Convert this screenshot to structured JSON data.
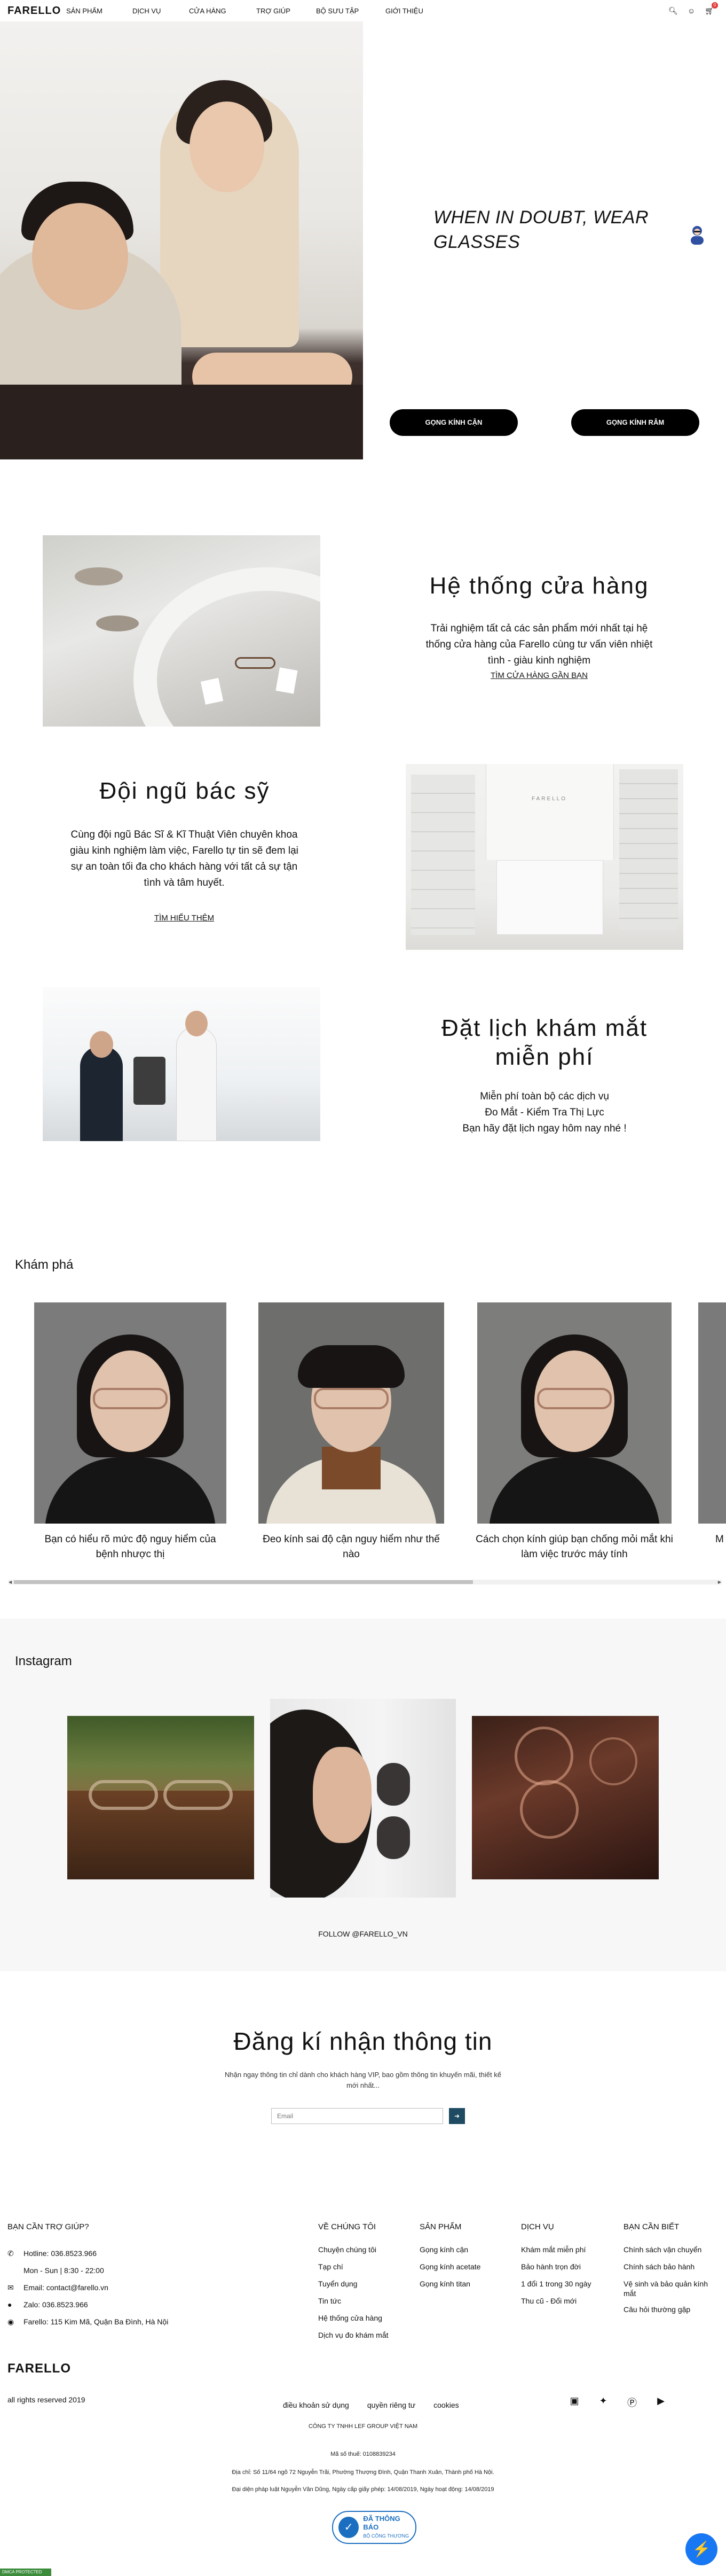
{
  "header": {
    "logo": "FARELLO",
    "nav": [
      "SẢN PHẨM",
      "DỊCH VỤ",
      "CỬA HÀNG",
      "TRỢ GIÚP",
      "BỘ SƯU TẬP",
      "GIỚI THIỆU"
    ],
    "icons": [
      "search-icon",
      "user-icon",
      "cart-icon"
    ],
    "cart_count": "0"
  },
  "hero": {
    "tagline_line1": "WHEN IN DOUBT, WEAR",
    "tagline_line2": "GLASSES",
    "btn_can": "GỌNG KÍNH CẬN",
    "btn_ram": "GỌNG KÍNH RÂM"
  },
  "store": {
    "title": "Hệ thống cửa hàng",
    "text": "Trải nghiệm tất cả các sản phẩm mới nhất tại hệ thống cửa hàng của Farello cùng tư vấn viên nhiệt tình - giàu kinh nghiệm",
    "link": "TÌM CỬA HÀNG GẦN BẠN"
  },
  "doctor": {
    "title": "Đội ngũ bác sỹ",
    "text": "Cùng đội ngũ Bác Sĩ & Kĩ Thuật Viên chuyên khoa giàu kinh nghiệm làm việc, Farello tự tin sẽ đem lại sự an toàn tối đa cho khách hàng với tất cả sự tận tình và tâm huyết.",
    "link": "TÌM HIỂU THÊM",
    "image_sign": "FARELLO"
  },
  "booking": {
    "title_line1": "Đặt lịch khám mắt",
    "title_line2": "miễn phí",
    "line1": "Miễn phí toàn bộ các dịch vụ",
    "line2": "Đo Mắt - Kiểm Tra Thị Lực",
    "line3": "Bạn hãy đặt lịch ngay hôm nay nhé !"
  },
  "explore": {
    "title": "Khám phá",
    "cards": [
      {
        "caption": "Bạn có hiểu rõ mức độ nguy hiểm của bệnh nhược thị"
      },
      {
        "caption": "Đeo kính sai độ cận nguy hiểm như thế nào"
      },
      {
        "caption": "Cách chọn kính giúp bạn chống mỏi mắt khi làm việc trước máy tính"
      },
      {
        "caption": "M"
      }
    ]
  },
  "instagram": {
    "title": "Instagram",
    "follow": "FOLLOW @FARELLO_VN"
  },
  "newsletter": {
    "title": "Đăng kí nhận thông tin",
    "desc": "Nhận ngay thông tin chỉ dành cho khách hàng VIP, bao gồm thông tin khuyến mãi, thiết kế mới nhất...",
    "placeholder": "Email",
    "submit_icon": "arrow-right-icon"
  },
  "footer": {
    "help_title": "BẠN CẦN TRỢ GIÚP?",
    "help": [
      {
        "icon": "phone-icon",
        "text": "Hotline: 036.8523.966"
      },
      {
        "icon": "",
        "text": "Mon - Sun | 8:30 - 22:00"
      },
      {
        "icon": "mail-icon",
        "text": "Email: contact@farello.vn"
      },
      {
        "icon": "zalo-icon",
        "text": "Zalo: 036.8523.966"
      },
      {
        "icon": "location-icon",
        "text": "Farello: 115 Kim Mã, Quận Ba Đình, Hà Nội"
      }
    ],
    "cols": [
      {
        "title": "VỀ CHÚNG TÔI",
        "items": [
          "Chuyện chúng tôi",
          "Tạp chí",
          "Tuyển dụng",
          "Tin tức",
          "Hệ thống cửa hàng",
          "Dịch vụ đo khám mắt"
        ]
      },
      {
        "title": "SẢN PHẨM",
        "items": [
          "Gọng kính cận",
          "Gọng kính acetate",
          "Gọng kính titan"
        ]
      },
      {
        "title": "DỊCH VỤ",
        "items": [
          "Khám mắt miễn phí",
          "Bảo hành trọn đời",
          "1 đổi 1 trong 30 ngày",
          "Thu cũ - Đổi mới"
        ]
      },
      {
        "title": "BẠN CẦN BIẾT",
        "items": [
          "Chính sách vận chuyển",
          "Chính sách bảo hành",
          "Vệ sinh và bảo quản kính mắt",
          "Câu hỏi thường gặp"
        ]
      }
    ],
    "logo": "FARELLO",
    "copyright": "all rights reserved 2019",
    "legal": [
      "điều khoản sử dụng",
      "quyền riêng tư",
      "cookies"
    ],
    "socials": [
      "facebook-icon",
      "twitter-icon",
      "pinterest-icon",
      "youtube-icon"
    ],
    "company_name": "CÔNG TY TNHH LEF GROUP VIỆT NAM",
    "tax": "Mã số thuế: 0108839234",
    "address": "Địa chỉ: Số 11/64 ngõ 72 Nguyễn Trãi, Phường Thượng Đình, Quận Thanh Xuân, Thành phố Hà Nội.",
    "license": "Đại diện pháp luật Nguyễn Văn Dũng, Ngày cấp giấy phép: 14/08/2019, Ngày hoạt động: 14/08/2019",
    "bct_title": "ĐÃ THÔNG BÁO",
    "bct_sub": "BỘ CÔNG THƯƠNG",
    "dmca": "DMCA PROTECTED"
  }
}
